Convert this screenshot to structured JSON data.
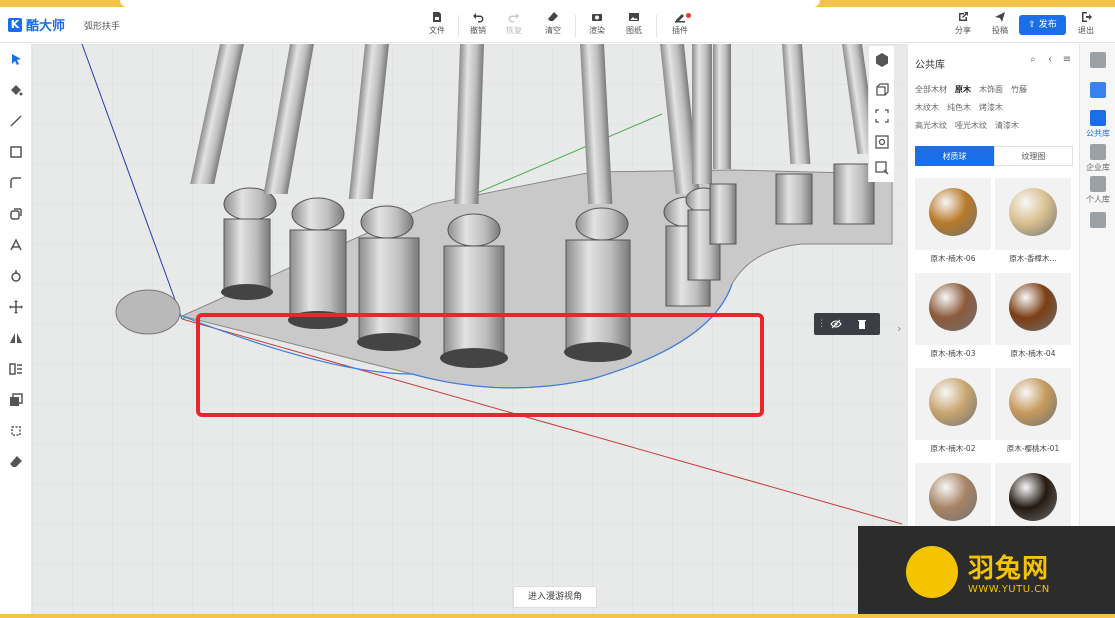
{
  "app": {
    "logo_text": "酷大师",
    "logo_mark": "K",
    "project_name": "弧形扶手"
  },
  "toolbar": {
    "file": "文件",
    "undo": "撤销",
    "redo": "恢复",
    "clear": "清空",
    "render": "渲染",
    "drawing": "图纸",
    "plugin": "插件",
    "share": "分享",
    "submit": "投稿",
    "publish": "发布",
    "exit": "退出"
  },
  "left_tools": [
    "select-icon",
    "paint-bucket-icon",
    "line-icon",
    "rectangle-icon",
    "arc-icon",
    "offset-icon",
    "text-icon",
    "rotate-icon",
    "move-icon",
    "mirror-icon",
    "array-icon",
    "copy-icon",
    "measure-icon",
    "eraser-icon"
  ],
  "view_tools": [
    "cube-view-icon",
    "box-icon",
    "fit-view-icon",
    "zoom-window-icon",
    "zoom-search-icon"
  ],
  "viewport": {
    "roam_button": "进入漫游视角"
  },
  "library": {
    "title": "公共库",
    "categories_row1": [
      "全部木材",
      "原木",
      "木饰面",
      "竹藤"
    ],
    "categories_row2": [
      "木纹木",
      "纯色木",
      "烤漆木"
    ],
    "categories_row3": [
      "高光木纹",
      "哑光木纹",
      "清漆木"
    ],
    "active_category": "原木",
    "tab_material": "材质球",
    "tab_texture": "纹理图",
    "materials": [
      {
        "name": "原木-楠木-06",
        "color": "#b97a2a"
      },
      {
        "name": "原木-香樟木...",
        "color": "#d9c08f"
      },
      {
        "name": "原木-楠木-03",
        "color": "#8b5a3a"
      },
      {
        "name": "原木-楠木-04",
        "color": "#7a3e14"
      },
      {
        "name": "原木-楠木-02",
        "color": "#c9a670"
      },
      {
        "name": "原木-樱桃木-01",
        "color": "#c69a5c"
      },
      {
        "name": "",
        "color": "#a88466"
      },
      {
        "name": "",
        "color": "#241a12"
      }
    ]
  },
  "side_nav": {
    "public": "公共库",
    "enterprise": "企业库",
    "personal": "个人库"
  },
  "watermark": {
    "title": "羽兔网",
    "url": "WWW.YUTU.CN"
  }
}
